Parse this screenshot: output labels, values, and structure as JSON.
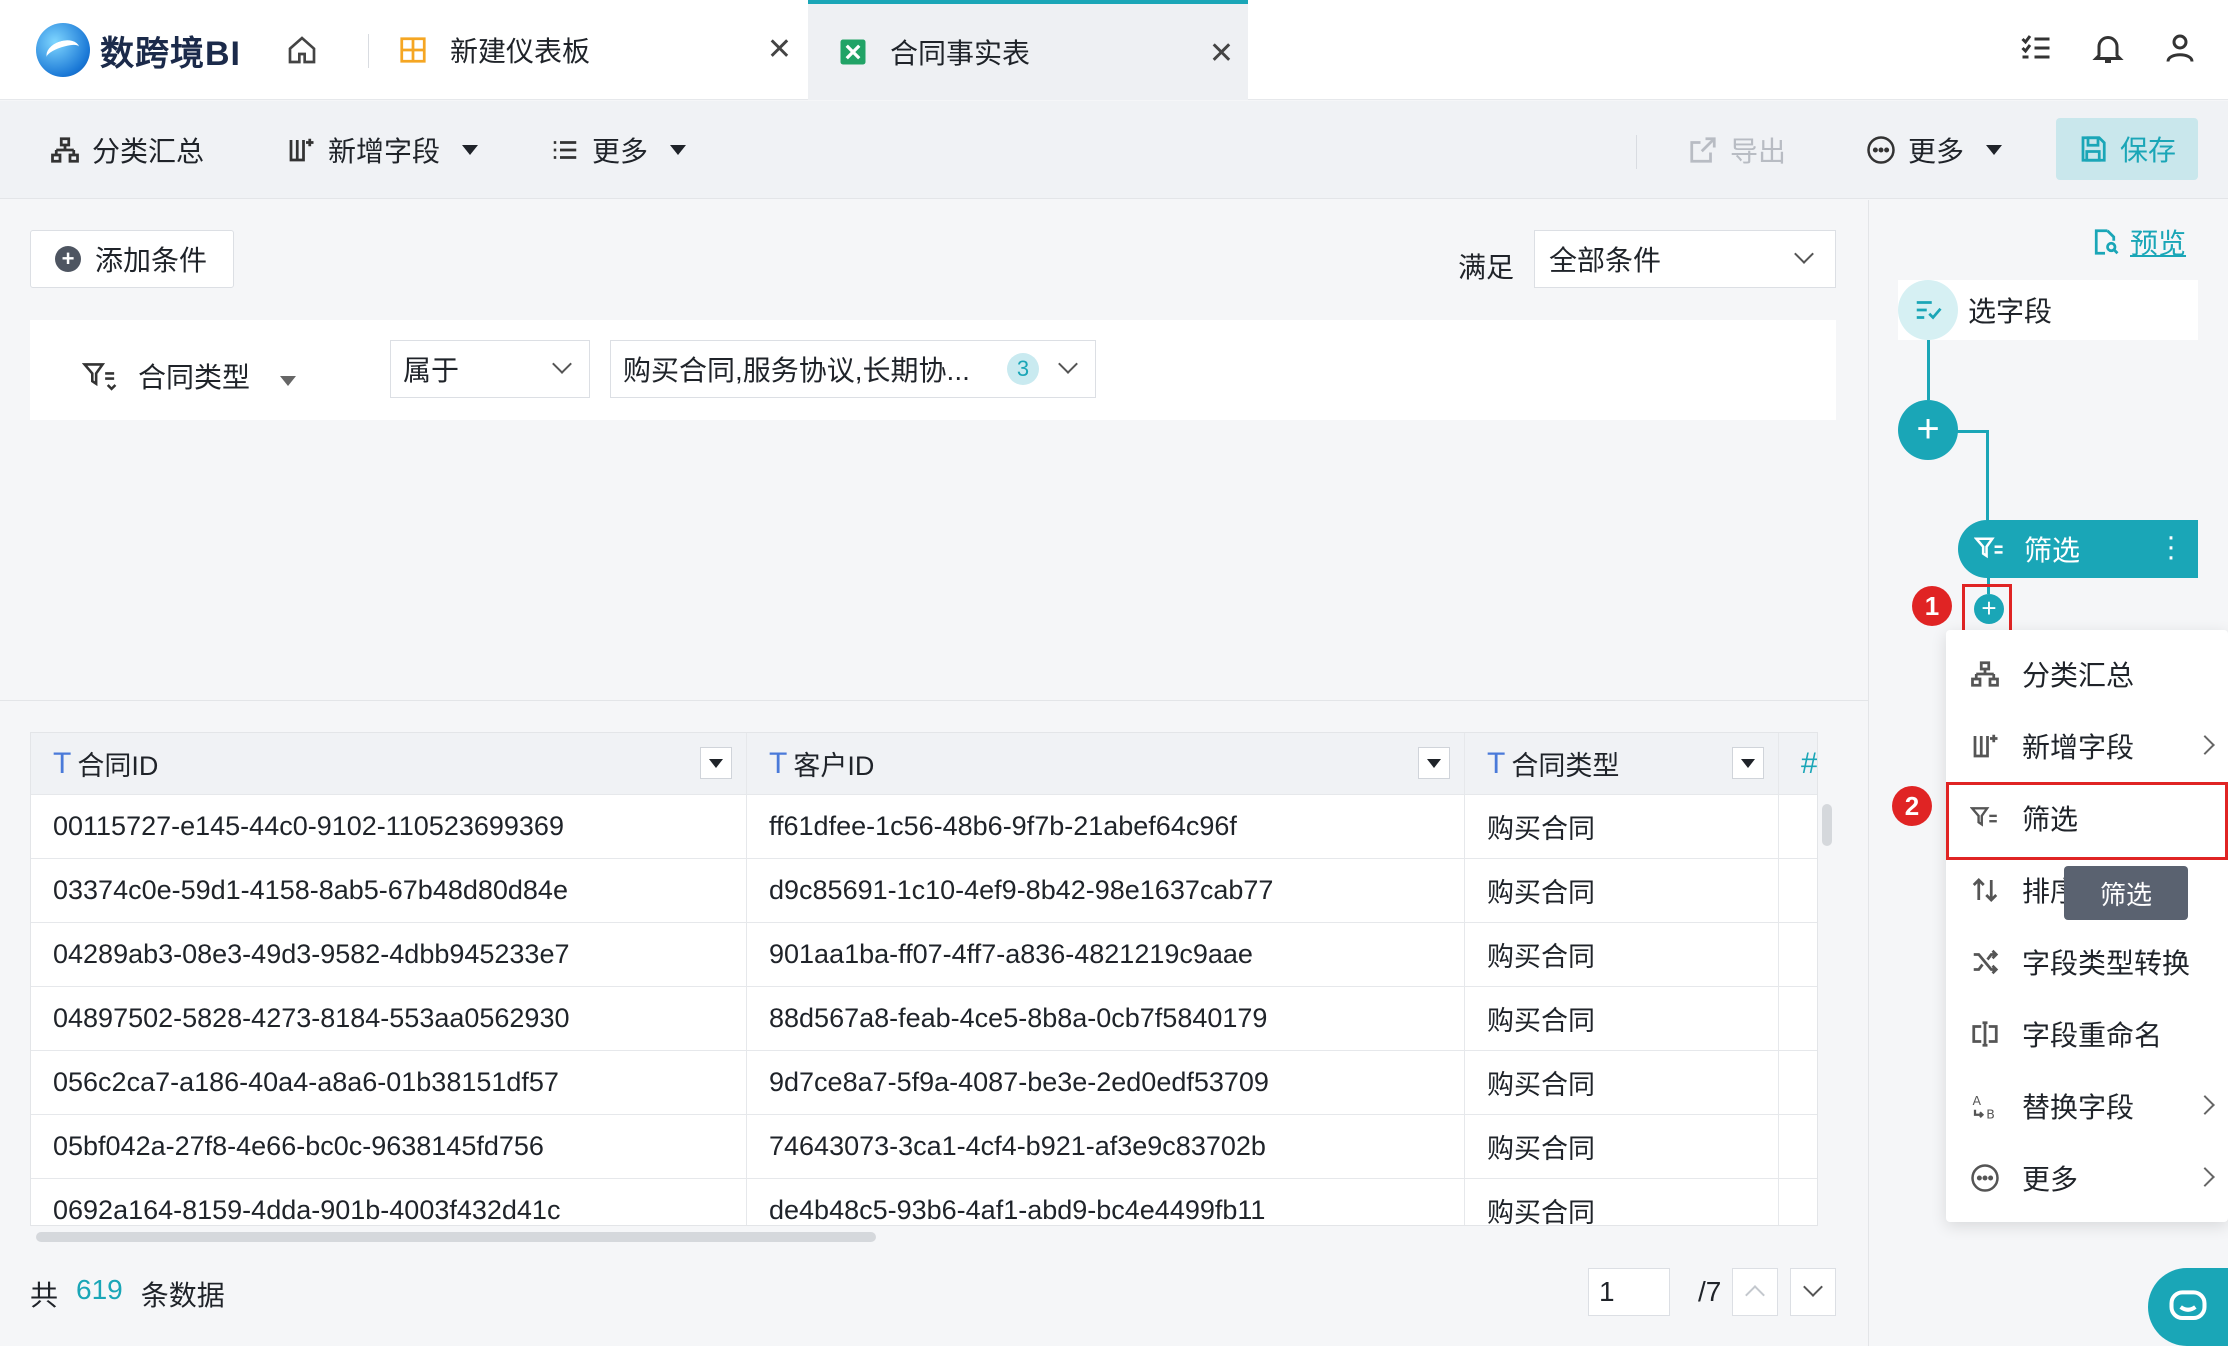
{
  "app": {
    "brand": "数跨境BI"
  },
  "tabs": [
    {
      "label": "新建仪表板",
      "icon": "dashboard-icon"
    },
    {
      "label": "合同事实表",
      "icon": "excel-icon",
      "active": true
    }
  ],
  "toolbar": {
    "group_summary": "分类汇总",
    "add_field": "新增字段",
    "more": "更多",
    "export": "导出",
    "more_right": "更多",
    "save": "保存"
  },
  "filter": {
    "add_condition": "添加条件",
    "satisfy_label": "满足",
    "satisfy_value": "全部条件",
    "condition": {
      "field": "合同类型",
      "operator": "属于",
      "value": "购买合同,服务协议,长期协...",
      "count": "3"
    }
  },
  "table": {
    "columns": [
      "合同ID",
      "客户ID",
      "合同类型"
    ],
    "rows": [
      [
        "00115727-e145-44c0-9102-110523699369",
        "ff61dfee-1c56-48b6-9f7b-21abef64c96f",
        "购买合同"
      ],
      [
        "03374c0e-59d1-4158-8ab5-67b48d80d84e",
        "d9c85691-1c10-4ef9-8b42-98e1637cab77",
        "购买合同"
      ],
      [
        "04289ab3-08e3-49d3-9582-4dbb945233e7",
        "901aa1ba-ff07-4ff7-a836-4821219c9aae",
        "购买合同"
      ],
      [
        "04897502-5828-4273-8184-553aa0562930",
        "88d567a8-feab-4ce5-8b8a-0cb7f5840179",
        "购买合同"
      ],
      [
        "056c2ca7-a186-40a4-a8a6-01b38151df57",
        "9d7ce8a7-5f9a-4087-be3e-2ed0edf53709",
        "购买合同"
      ],
      [
        "05bf042a-27f8-4e66-bc0c-9638145fd756",
        "74643073-3ca1-4cf4-b921-af3e9c83702b",
        "购买合同"
      ],
      [
        "0692a164-8159-4dda-901b-4003f432d41c",
        "de4b48c5-93b6-4af1-abd9-bc4e4499fb11",
        "购买合同"
      ]
    ]
  },
  "footer": {
    "prefix": "共",
    "total": "619",
    "suffix": "条数据",
    "page": "1",
    "page_total": "/7"
  },
  "flow": {
    "preview": "预览",
    "node_select": "选字段",
    "node_filter": "筛选",
    "step1": "1",
    "step2": "2"
  },
  "context_menu": {
    "items": [
      {
        "label": "分类汇总",
        "icon": "group-summary-icon",
        "submenu": false
      },
      {
        "label": "新增字段",
        "icon": "add-field-icon",
        "submenu": true
      },
      {
        "label": "筛选",
        "icon": "filter-icon",
        "submenu": false
      },
      {
        "label": "排序",
        "icon": "sort-icon",
        "submenu": false
      },
      {
        "label": "字段类型转换",
        "icon": "shuffle-icon",
        "submenu": false
      },
      {
        "label": "字段重命名",
        "icon": "rename-icon",
        "submenu": false
      },
      {
        "label": "替换字段",
        "icon": "replace-icon",
        "submenu": true
      },
      {
        "label": "更多",
        "icon": "more-circle-icon",
        "submenu": true
      }
    ],
    "tooltip": "筛选"
  },
  "colors": {
    "accent": "#1aa6b7",
    "highlight": "#e02424"
  }
}
